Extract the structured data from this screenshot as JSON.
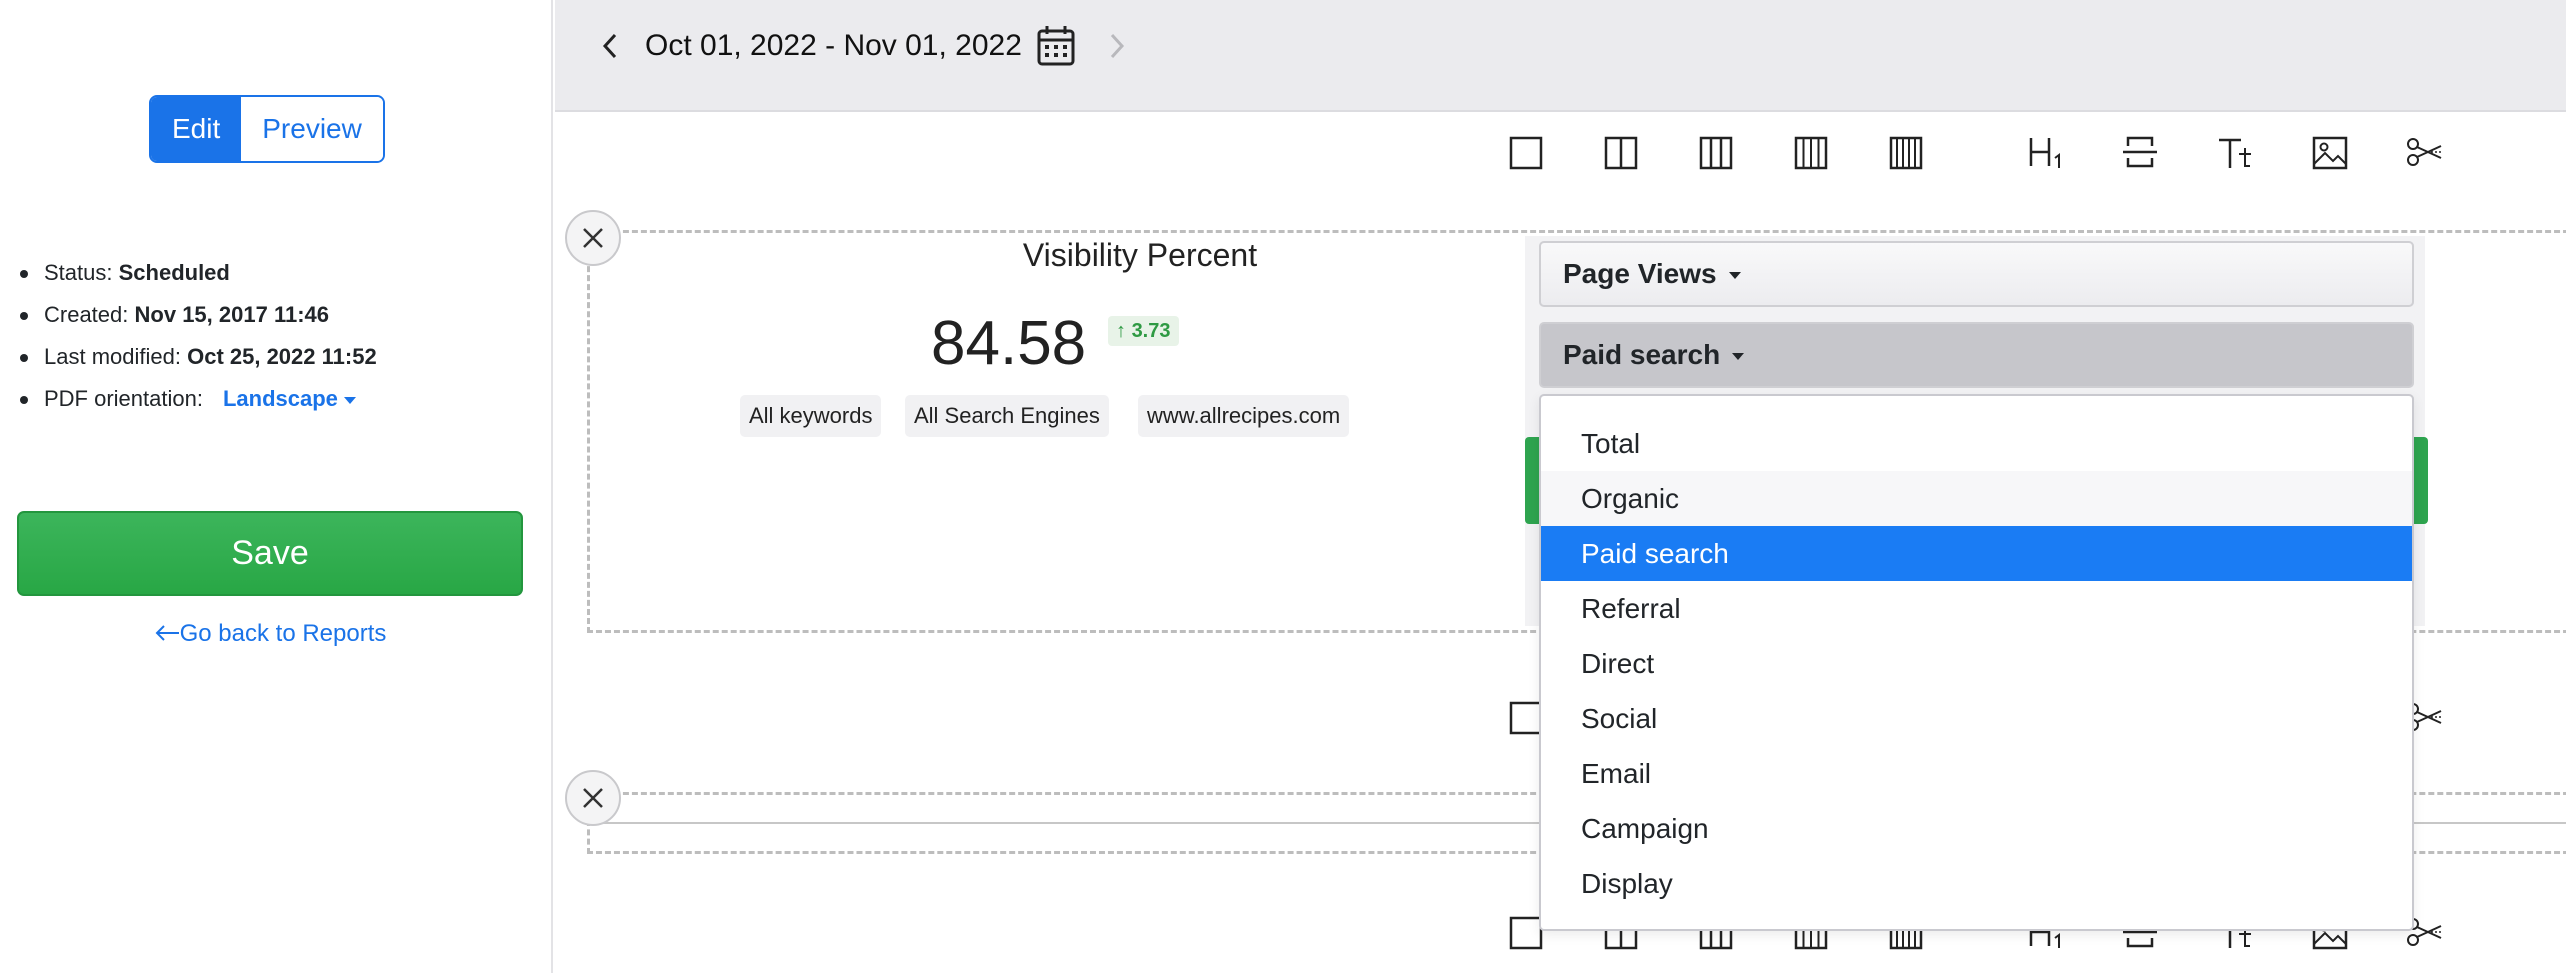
{
  "mode_toggle": {
    "edit": "Edit",
    "preview": "Preview"
  },
  "meta": {
    "status_label": "Status:",
    "status_value": "Scheduled",
    "created_label": "Created:",
    "created_value": "Nov 15, 2017 11:46",
    "modified_label": "Last modified:",
    "modified_value": "Oct 25, 2022 11:52",
    "orientation_label": "PDF orientation:",
    "orientation_value": "Landscape"
  },
  "save_label": "Save",
  "back_link": "Go back to Reports",
  "date_range": "Oct 01, 2022 - Nov 01, 2022",
  "widget": {
    "title": "Visibility Percent",
    "value": "84.58",
    "delta": "3.73",
    "chips": [
      "All keywords",
      "All Search Engines",
      "www.allrecipes.com"
    ]
  },
  "metric_dropdown": "Page Views",
  "source_dropdown": "Paid search",
  "source_options": [
    "Total",
    "Organic",
    "Paid search",
    "Referral",
    "Direct",
    "Social",
    "Email",
    "Campaign",
    "Display"
  ],
  "source_selected": "Paid search",
  "source_hovered": "Organic",
  "toolbar_icons": [
    "layout-1-col-icon",
    "layout-2-col-icon",
    "layout-3-col-icon",
    "layout-4-col-icon",
    "layout-5-col-icon",
    "heading-icon",
    "page-break-icon",
    "text-icon",
    "image-icon",
    "scissors-icon"
  ],
  "colors": {
    "accent": "#1a73e8",
    "save": "#2ea44f",
    "selected": "#1a7cf4",
    "delta": "#2e9a43"
  }
}
